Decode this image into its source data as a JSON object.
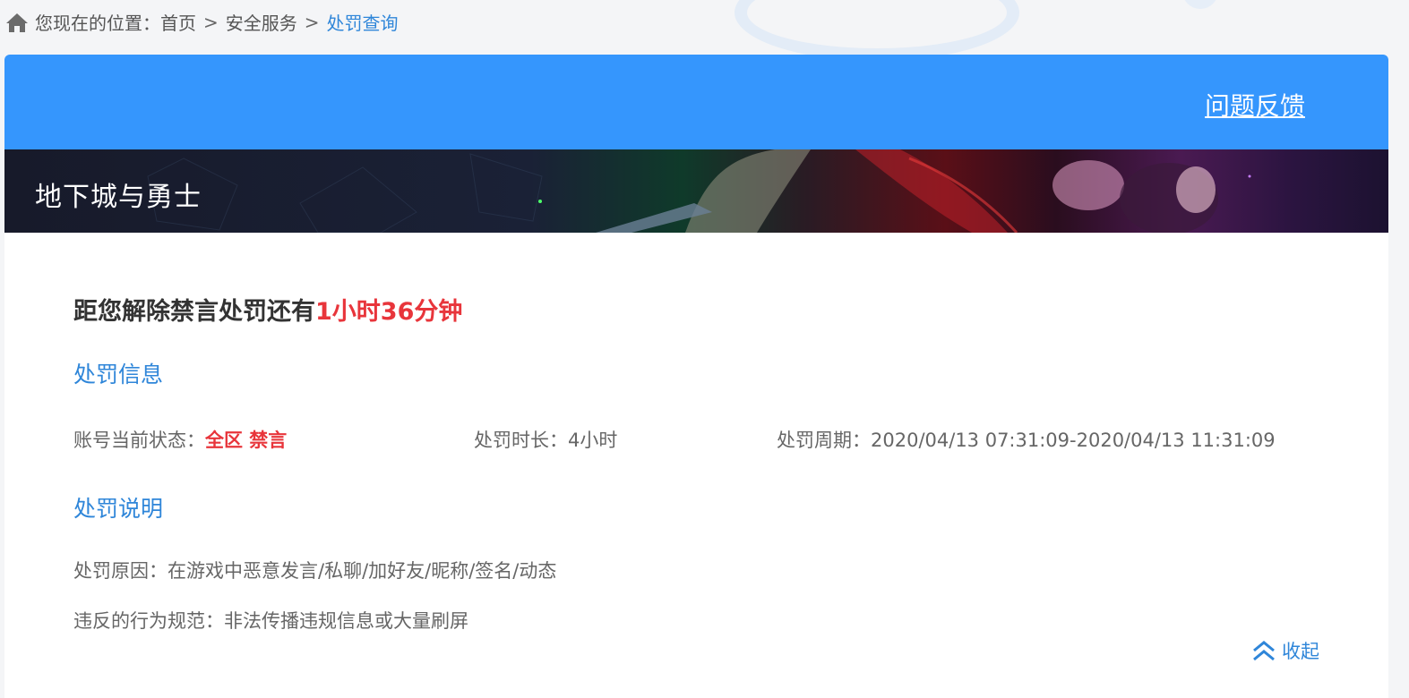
{
  "breadcrumb": {
    "prefix": "您现在的位置：",
    "items": [
      "首页",
      "安全服务"
    ],
    "separator": ">",
    "current": "处罚查询"
  },
  "header": {
    "feedback_label": "问题反馈",
    "accent_color": "#3596fd"
  },
  "banner": {
    "game_title": "地下城与勇士"
  },
  "countdown": {
    "prefix": "距您解除禁言处罚还有",
    "remaining": "1小时36分钟"
  },
  "penalty_info": {
    "title": "处罚信息",
    "status_label": "账号当前状态：",
    "status_value": "全区 禁言",
    "duration_label": "处罚时长：",
    "duration_value": "4小时",
    "period_label": "处罚周期：",
    "period_value": "2020/04/13 07:31:09-2020/04/13 11:31:09"
  },
  "penalty_desc": {
    "title": "处罚说明",
    "reason_label": "处罚原因：",
    "reason_value": "在游戏中恶意发言/私聊/加好友/昵称/签名/动态",
    "rule_label": "违反的行为规范：",
    "rule_value": "非法传播违规信息或大量刷屏"
  },
  "collapse_label": "收起",
  "colors": {
    "link_blue": "#2f86d9",
    "alert_red": "#e8353b"
  }
}
